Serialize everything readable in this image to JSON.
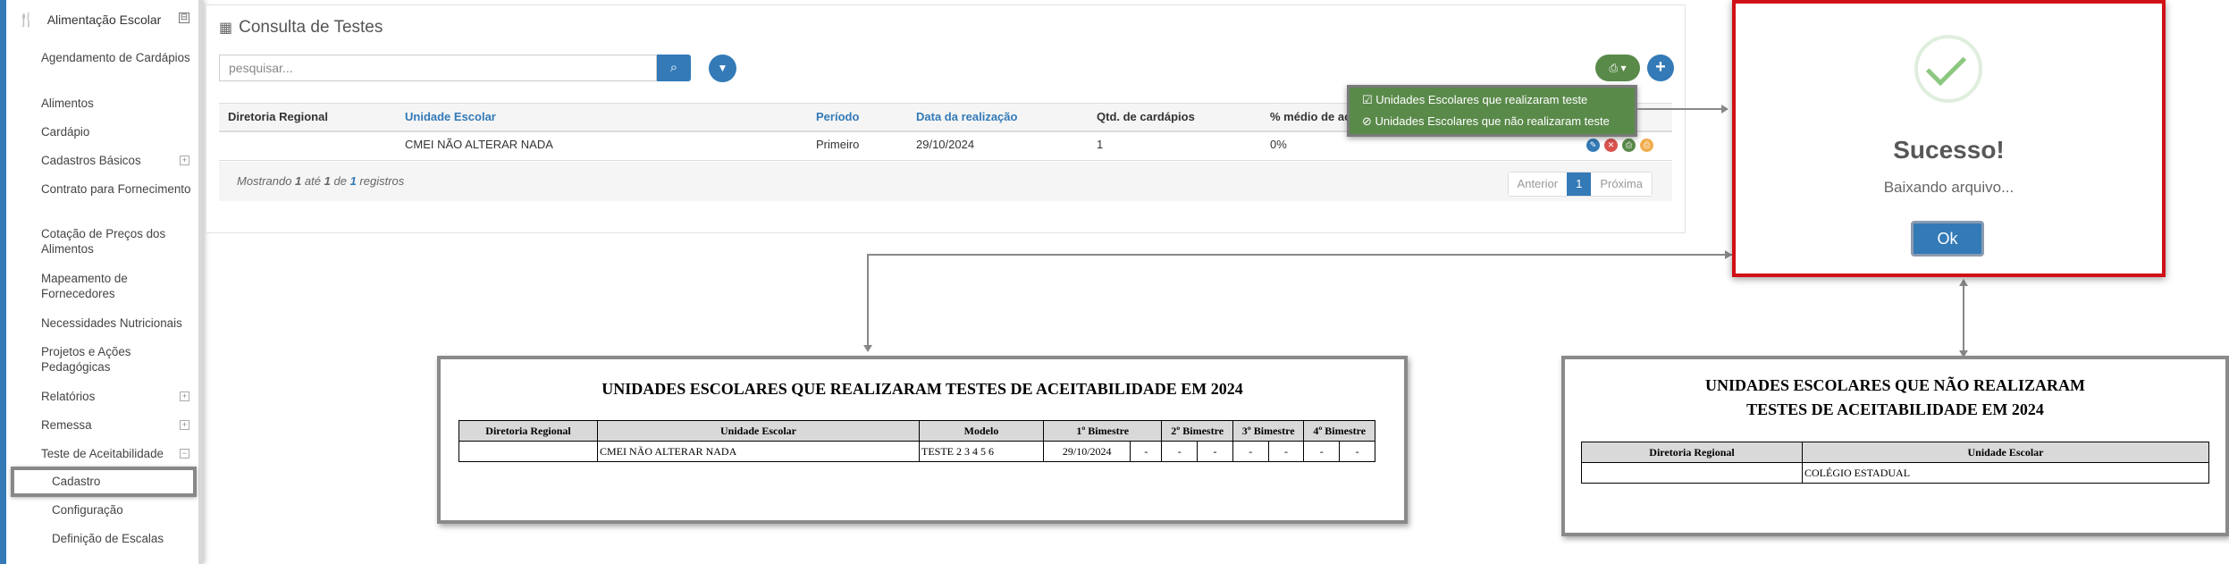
{
  "sidebar": {
    "section_label": "Alimentação Escolar",
    "section_toggle": "⊟",
    "items": [
      {
        "label": "Agendamento de Cardápios",
        "toggle": ""
      },
      {
        "label": "Alimentos",
        "toggle": ""
      },
      {
        "label": "Cardápio",
        "toggle": ""
      },
      {
        "label": "Cadastros Básicos",
        "toggle": "+"
      },
      {
        "label": "Contrato para Fornecimento",
        "toggle": ""
      },
      {
        "label": "Cotação de Preços dos Alimentos",
        "toggle": ""
      },
      {
        "label": "Mapeamento de Fornecedores",
        "toggle": ""
      },
      {
        "label": "Necessidades Nutricionais",
        "toggle": ""
      },
      {
        "label": "Projetos e Ações Pedagógicas",
        "toggle": ""
      },
      {
        "label": "Relatórios",
        "toggle": "+"
      },
      {
        "label": "Remessa",
        "toggle": "+"
      },
      {
        "label": "Teste de Aceitabilidade",
        "toggle": "−"
      }
    ],
    "subitems": [
      "Cadastro",
      "Configuração",
      "Definição de Escalas"
    ]
  },
  "panel": {
    "title": "Consulta de Testes",
    "search_placeholder": "pesquisar...",
    "columns": [
      "Diretoria Regional",
      "Unidade Escolar",
      "Período",
      "Data da realização",
      "Qtd. de cardápios",
      "% médio de ac"
    ],
    "rows": [
      {
        "diretoria": "",
        "unidade": "CMEI NÃO ALTERAR NADA",
        "periodo": "Primeiro",
        "data": "29/10/2024",
        "qtd": "1",
        "pct": "0%"
      }
    ],
    "footer": {
      "prefix": "Mostrando",
      "from": "1",
      "mid1": "até",
      "to": "1",
      "mid2": "de",
      "total": "1",
      "suffix": "registros"
    },
    "pager": {
      "prev": "Anterior",
      "current": "1",
      "next": "Próxima"
    }
  },
  "dropdown": {
    "items": [
      "Unidades Escolares que realizaram teste",
      "Unidades Escolares que não realizaram teste"
    ]
  },
  "modal": {
    "title": "Sucesso!",
    "text": "Baixando arquivo...",
    "ok_label": "Ok"
  },
  "report1": {
    "title": "UNIDADES ESCOLARES QUE REALIZARAM TESTES DE ACEITABILIDADE EM 2024",
    "headers": [
      "Diretoria Regional",
      "Unidade Escolar",
      "Modelo",
      "1º Bimestre",
      "2º Bimestre",
      "3º Bimestre",
      "4º Bimestre"
    ],
    "row": {
      "diretoria": "",
      "unidade": "CMEI NÃO ALTERAR NADA",
      "modelo": "TESTE 2 3 4 5 6",
      "b1a": "29/10/2024",
      "b1b": "-",
      "b2a": "-",
      "b2b": "-",
      "b3a": "-",
      "b3b": "-",
      "b4a": "-",
      "b4b": "-"
    }
  },
  "report2": {
    "title_line1": "UNIDADES ESCOLARES QUE NÃO REALIZARAM",
    "title_line2": "TESTES DE ACEITABILIDADE EM 2024",
    "headers": [
      "Diretoria Regional",
      "Unidade Escolar"
    ],
    "row": {
      "diretoria": "",
      "unidade": "COLÉGIO ESTADUAL"
    }
  },
  "colors": {
    "primary": "#337ab7",
    "print_green": "#5a8a4a",
    "modal_border": "#d10f16",
    "success_check": "#8cc77f"
  }
}
